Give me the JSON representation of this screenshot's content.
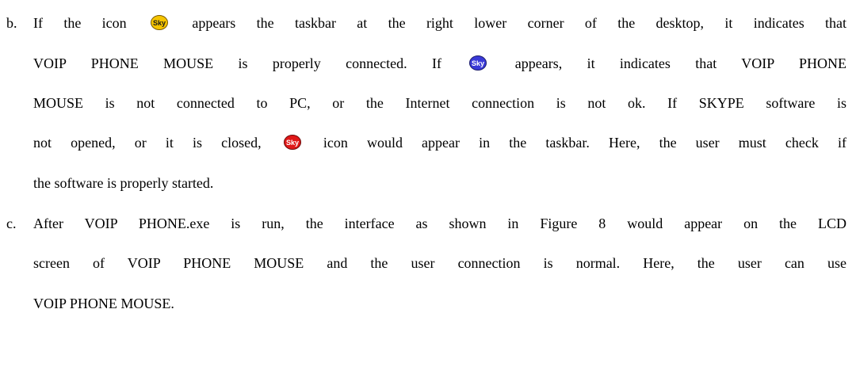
{
  "document": {
    "items": [
      {
        "marker": "b.",
        "lines": [
          {
            "before": "If the icon",
            "after": "appears the taskbar at the right lower corner of the desktop, it indicates that"
          },
          {
            "before": "VOIP PHONE MOUSE is properly connected. If",
            "after": "appears, it indicates that VOIP PHONE"
          },
          {
            "text": "MOUSE is not connected to PC, or the Internet connection is not ok. If SKYPE software is"
          },
          {
            "before": "not opened, or it is closed,",
            "after": "icon would appear in the taskbar. Here, the user must check if"
          },
          {
            "text": "the software is properly started."
          }
        ]
      },
      {
        "marker": "c.",
        "lines": [
          {
            "text": "After VOIP PHONE.exe is run, the interface as shown in Figure 8 would appear on the LCD"
          },
          {
            "text": "screen of VOIP PHONE MOUSE and the user connection is normal. Here, the user can use"
          },
          {
            "text": "VOIP PHONE MOUSE."
          }
        ]
      }
    ],
    "icons": {
      "connected": {
        "name": "sky-connected-icon",
        "color": "#f5c400",
        "text": "Sky"
      },
      "disconnected": {
        "name": "sky-disconnected-icon",
        "color": "#3a3ad8",
        "text": "Sky"
      },
      "closed": {
        "name": "sky-closed-icon",
        "color": "#e01818",
        "text": "Sky"
      }
    }
  }
}
